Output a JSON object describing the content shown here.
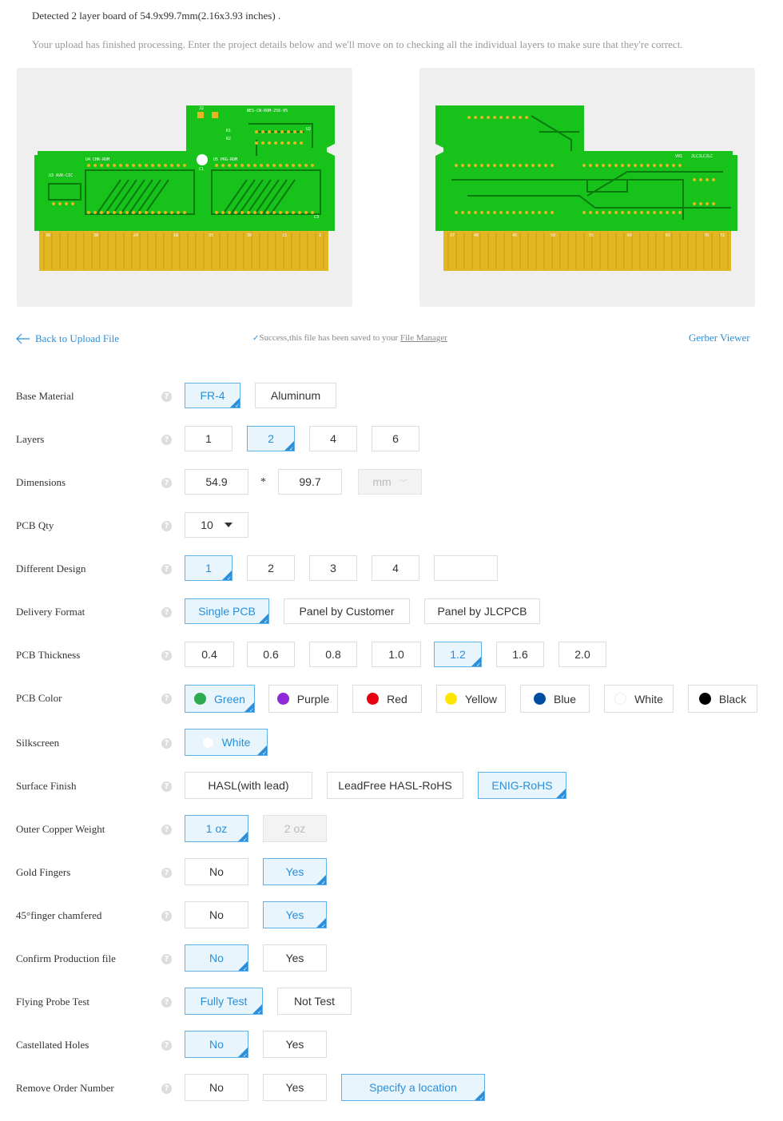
{
  "header": {
    "detected": "Detected 2 layer board of 54.9x99.7mm(2.16x3.93 inches) .",
    "hint": "Your upload has finished processing. Enter the project details below and we'll move on to checking all the individual layers to make sure that they're correct."
  },
  "nav": {
    "back": "Back to Upload File",
    "success_text": "Success,this file has been saved to your ",
    "file_manager": "File Manager",
    "gerber_viewer": "Gerber Viewer"
  },
  "pcb": {
    "top_labels": [
      "U4 CHR-ROM",
      "U5 PRG-ROM",
      "U3 AVR-CIC",
      "NES-CN-ROM-256-05",
      "U2",
      "J2",
      "C1",
      "C3",
      "R1",
      "R2"
    ],
    "top_pins": [
      "36",
      "30",
      "24",
      "18",
      "35",
      "30",
      "15",
      "1"
    ],
    "bottom_labels": [
      "V01",
      "JLCJLCJLC"
    ],
    "bottom_pins": [
      "37",
      "40",
      "45",
      "50",
      "55",
      "60",
      "65",
      "70",
      "72"
    ],
    "colors": {
      "board": "#17c31b",
      "trace": "#0a7a0f",
      "gold": "#e3b624",
      "bg": "#efefef"
    }
  },
  "form": {
    "base_material": {
      "label": "Base Material",
      "options": [
        "FR-4",
        "Aluminum"
      ],
      "selected": "FR-4"
    },
    "layers": {
      "label": "Layers",
      "options": [
        "1",
        "2",
        "4",
        "6"
      ],
      "selected": "2"
    },
    "dimensions": {
      "label": "Dimensions",
      "width": "54.9",
      "height": "99.7",
      "times": "*",
      "unit": "mm"
    },
    "pcb_qty": {
      "label": "PCB Qty",
      "value": "10"
    },
    "different_design": {
      "label": "Different Design",
      "options": [
        "1",
        "2",
        "3",
        "4"
      ],
      "selected": "1"
    },
    "delivery_format": {
      "label": "Delivery Format",
      "options": [
        "Single PCB",
        "Panel by Customer",
        "Panel by JLCPCB"
      ],
      "selected": "Single PCB"
    },
    "pcb_thickness": {
      "label": "PCB Thickness",
      "options": [
        "0.4",
        "0.6",
        "0.8",
        "1.0",
        "1.2",
        "1.6",
        "2.0"
      ],
      "selected": "1.2"
    },
    "pcb_color": {
      "label": "PCB Color",
      "options": [
        {
          "name": "Green",
          "color": "#2dab4f"
        },
        {
          "name": "Purple",
          "color": "#8e2bd6"
        },
        {
          "name": "Red",
          "color": "#e60012"
        },
        {
          "name": "Yellow",
          "color": "#ffe600"
        },
        {
          "name": "Blue",
          "color": "#004ea2"
        },
        {
          "name": "White",
          "color": "#ffffff"
        },
        {
          "name": "Black",
          "color": "#000000"
        }
      ],
      "selected": "Green"
    },
    "silkscreen": {
      "label": "Silkscreen",
      "value": "White",
      "color": "#ffffff"
    },
    "surface_finish": {
      "label": "Surface Finish",
      "options": [
        "HASL(with lead)",
        "LeadFree HASL-RoHS",
        "ENIG-RoHS"
      ],
      "selected": "ENIG-RoHS"
    },
    "outer_copper": {
      "label": "Outer Copper Weight",
      "options": [
        "1 oz",
        "2 oz"
      ],
      "selected": "1 oz",
      "disabled": "2 oz"
    },
    "gold_fingers": {
      "label": "Gold Fingers",
      "options": [
        "No",
        "Yes"
      ],
      "selected": "Yes"
    },
    "finger_chamfered": {
      "label": "45°finger chamfered",
      "options": [
        "No",
        "Yes"
      ],
      "selected": "Yes"
    },
    "confirm_production": {
      "label": "Confirm Production file",
      "options": [
        "No",
        "Yes"
      ],
      "selected": "No"
    },
    "flying_probe": {
      "label": "Flying Probe Test",
      "options": [
        "Fully Test",
        "Not Test"
      ],
      "selected": "Fully Test"
    },
    "castellated_holes": {
      "label": "Castellated Holes",
      "options": [
        "No",
        "Yes"
      ],
      "selected": "No"
    },
    "remove_order_number": {
      "label": "Remove Order Number",
      "options": [
        "No",
        "Yes",
        "Specify a location"
      ],
      "selected": "Specify a location"
    }
  },
  "accent_color": "#2a8fd8"
}
